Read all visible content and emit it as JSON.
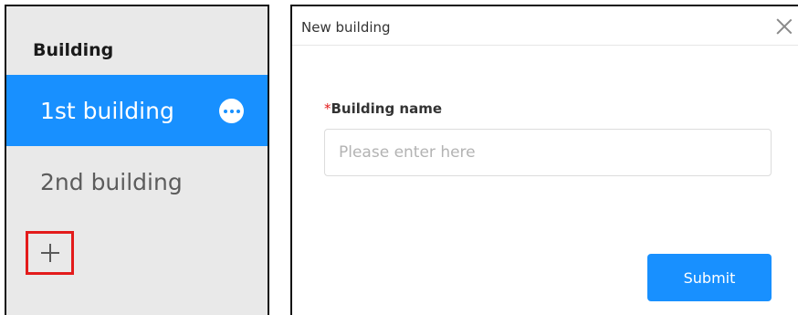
{
  "sidebar": {
    "title": "Building",
    "items": [
      {
        "label": "1st building",
        "active": true
      },
      {
        "label": "2nd building",
        "active": false
      }
    ],
    "more_icon": "ellipsis-icon",
    "add_icon": "plus-icon"
  },
  "dialog": {
    "title": "New building",
    "close_icon": "close-icon",
    "field": {
      "required_mark": "*",
      "label": "Building name",
      "value": "",
      "placeholder": "Please enter here"
    },
    "submit_label": "Submit"
  },
  "colors": {
    "accent": "#1890ff",
    "highlight_border": "#e31b1b",
    "sidebar_bg": "#e9e9e9"
  }
}
